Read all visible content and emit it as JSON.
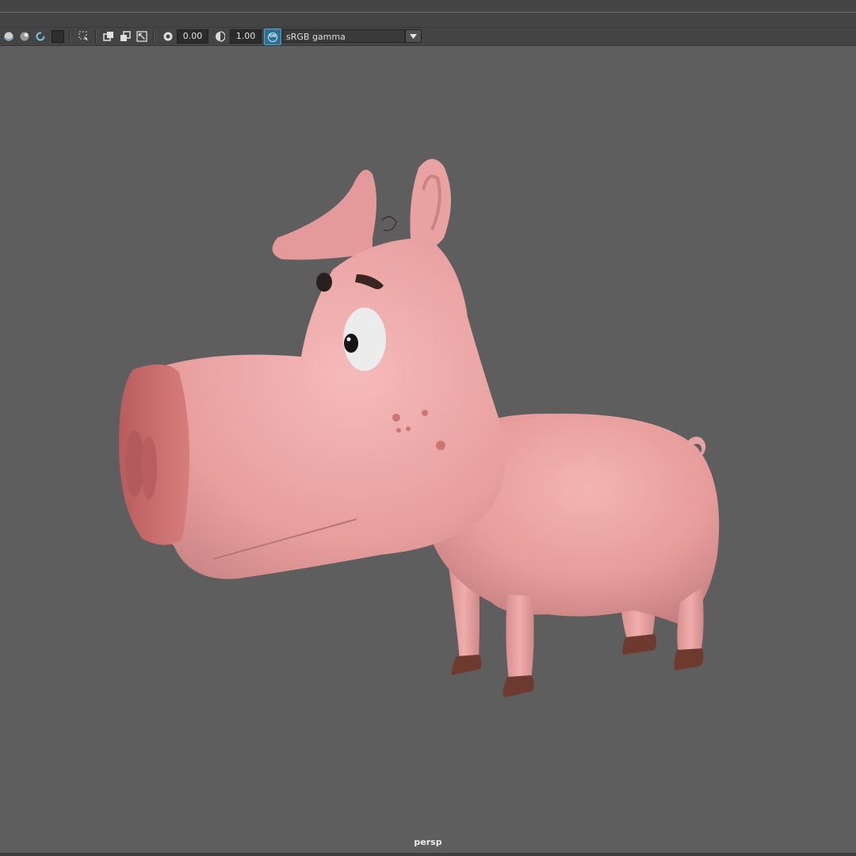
{
  "toolbar": {
    "exposure_value": "0.00",
    "gamma_value": "1.00",
    "color_management_label": "ON",
    "color_space": "sRGB gamma",
    "icons": [
      "shaded-sphere-icon",
      "textured-sphere-icon",
      "refresh-icon",
      "dark-square-icon",
      "select-grid-icon",
      "isolate-icon",
      "copy-icon",
      "resize-icon",
      "exposure-icon",
      "gamma-icon"
    ]
  },
  "viewport": {
    "camera_label": "persp",
    "background_color": "#5e5e5e",
    "subject": "pig-model"
  },
  "colors": {
    "skin": "#e69c9b",
    "snout": "#c96a6a",
    "hoof": "#6e3a30"
  }
}
